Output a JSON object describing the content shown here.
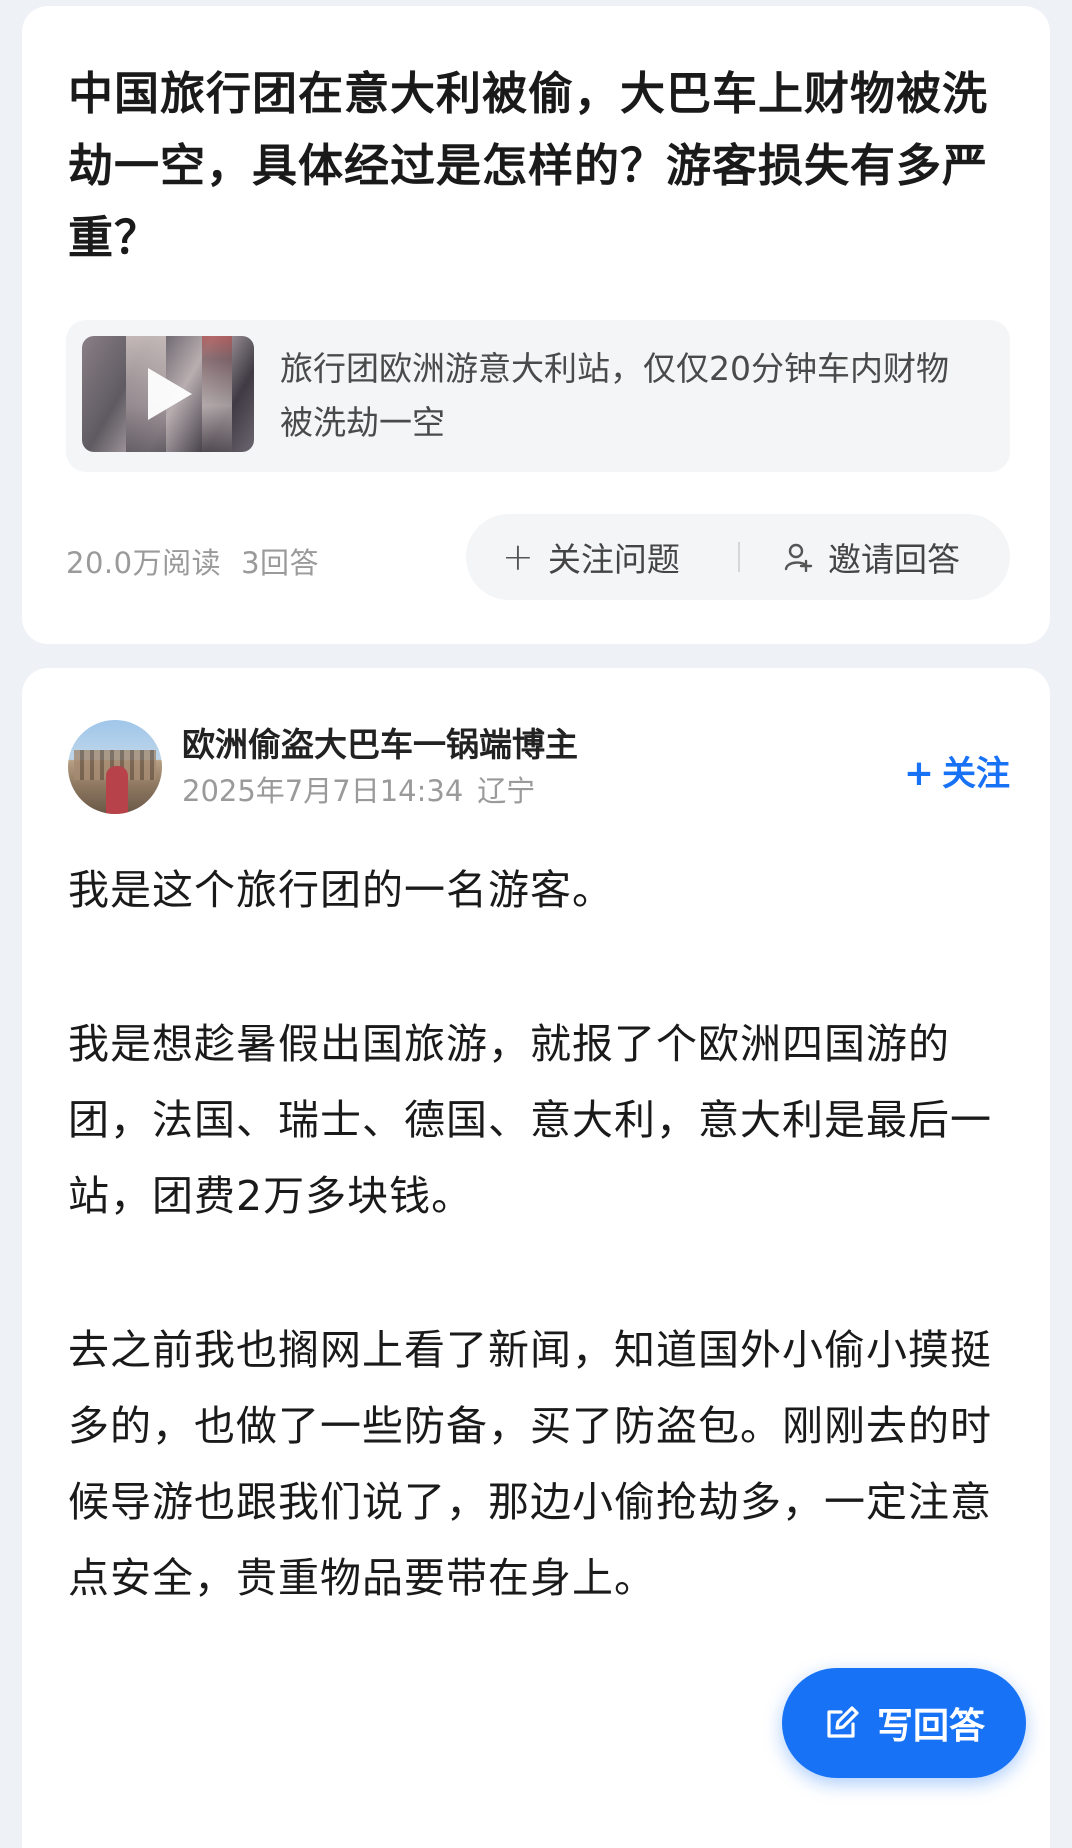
{
  "question": {
    "title": "中国旅行团在意大利被偷，大巴车上财物被洗劫一空，具体经过是怎样的？游客损失有多严重？",
    "video": {
      "caption": "旅行团欧洲游意大利站，仅仅20分钟车内财物被洗劫一空",
      "icon": "play-icon"
    },
    "stats": {
      "views": "20.0万阅读",
      "answers": "3回答"
    },
    "actions": {
      "follow_label": "关注问题",
      "invite_label": "邀请回答"
    }
  },
  "answer": {
    "author": {
      "name": "欧洲偷盗大巴车一锅端博主",
      "date": "2025年7月7日14:34",
      "location": "辽宁"
    },
    "follow_label": "关注",
    "paragraphs": [
      "我是这个旅行团的一名游客。",
      "我是想趁暑假出国旅游，就报了个欧洲四国游的团，法国、瑞士、德国、意大利，意大利是最后一站，团费2万多块钱。",
      "去之前我也搁网上看了新闻，知道国外小偷小摸挺多的，也做了一些防备，买了防盗包。刚刚去的时候导游也跟我们说了，那边小偷抢劫多，一定注意点安全，贵重物品要带在身上。"
    ]
  },
  "fab": {
    "label": "写回答",
    "icon": "edit-icon"
  },
  "colors": {
    "accent": "#1772f6",
    "background": "#eef1f6",
    "muted_text": "#9a9a9a"
  }
}
